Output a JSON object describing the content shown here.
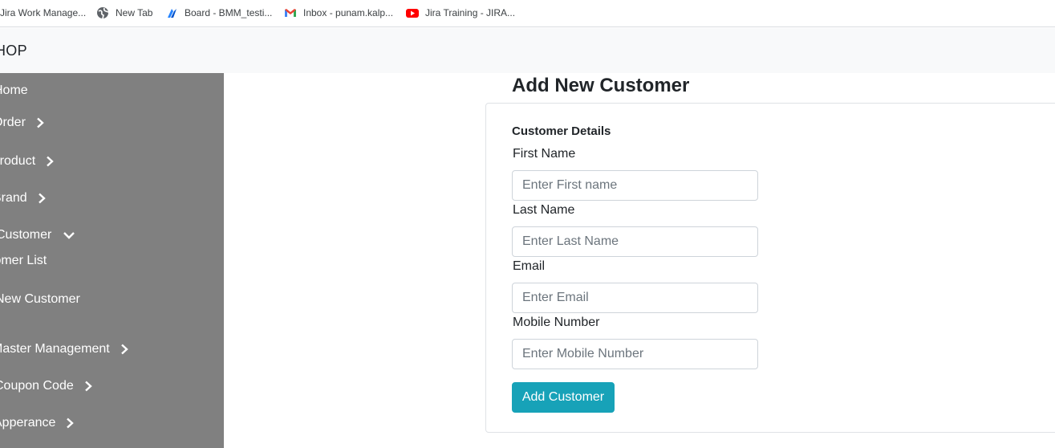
{
  "bookmarks": [
    {
      "label": "Jira Work Manage...",
      "icon": "jira-icon"
    },
    {
      "label": "New Tab",
      "icon": "globe-icon"
    },
    {
      "label": "Board - BMM_testi...",
      "icon": "jira-board-icon"
    },
    {
      "label": "Inbox - punam.kalp...",
      "icon": "gmail-icon"
    },
    {
      "label": "Jira Training - JIRA...",
      "icon": "youtube-icon"
    }
  ],
  "navbar": {
    "brand": "HOP"
  },
  "sidebar": {
    "items": [
      {
        "label": "Home"
      },
      {
        "label": "Order",
        "chevron": "right"
      },
      {
        "label": "Product",
        "chevron": "right"
      },
      {
        "label": "Brand",
        "chevron": "right"
      },
      {
        "label": "Customer",
        "chevron": "down"
      },
      {
        "label": "tomer List"
      },
      {
        "label": "l New Customer"
      },
      {
        "label": "Master Management",
        "chevron": "right"
      },
      {
        "label": "Coupon Code",
        "chevron": "right"
      },
      {
        "label": "Apperance",
        "chevron": "right"
      }
    ]
  },
  "main": {
    "title": "Add New Customer",
    "form": {
      "heading": "Customer Details",
      "first_name": {
        "label": "First Name",
        "placeholder": "Enter First name",
        "value": ""
      },
      "last_name": {
        "label": "Last Name",
        "placeholder": "Enter Last Name",
        "value": ""
      },
      "email": {
        "label": "Email",
        "placeholder": "Enter Email",
        "value": ""
      },
      "mobile": {
        "label": "Mobile Number",
        "placeholder": "Enter Mobile Number",
        "value": ""
      },
      "submit_label": "Add Customer"
    }
  },
  "colors": {
    "sidebar_bg": "#808080",
    "navbar_bg": "#f8f9fa",
    "button_bg": "#17a2b8"
  }
}
